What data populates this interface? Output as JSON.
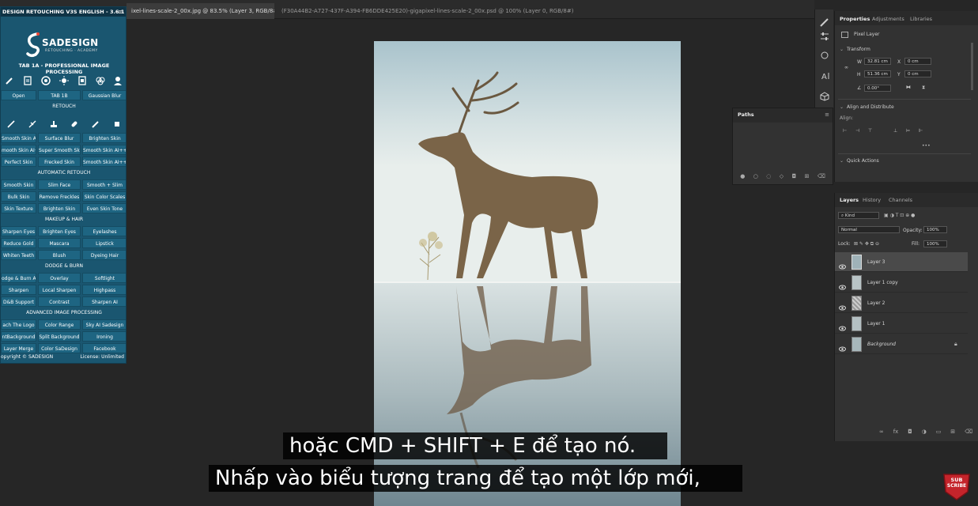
{
  "tabs": {
    "active": "ixel-lines-scale-2_00x.jpg @ 83.5% (Layer 3, RGB/8#) *",
    "second": "(F30A44B2-A727-437F-A394-FB6DDE425E20)-gigapixel-lines-scale-2_00x.psd @ 100% (Layer 0, RGB/8#)",
    "close": "×"
  },
  "plugin": {
    "title": "DESIGN RETOUCHING V3S ENGLISH - 3.6.1",
    "menu": "≡",
    "logo_name": "SADESIGN",
    "logo_sub": "RETOUCHING · ACADEMY",
    "tab_heading": "TAB 1A - PROFESSIONAL IMAGE PROCESSING",
    "top_buttons": [
      "Open",
      "TAB 1B",
      "Gaussian Blur"
    ],
    "sections": [
      {
        "title": "RETOUCH"
      },
      {
        "title": "AUTOMATIC RETOUCH"
      },
      {
        "title": "MAKEUP & HAIR"
      },
      {
        "title": "DODGE & BURN"
      },
      {
        "title": "ADVANCED IMAGE PROCESSING"
      }
    ],
    "retouch_rows": [
      [
        "Smooth Skin AI",
        "Surface Blur",
        "Brighten Skin"
      ],
      [
        "mooth Skin AI+",
        "Super Smooth Skin",
        "Smooth Skin AI++"
      ],
      [
        "Perfect Skin",
        "Frecked Skin",
        "Smooth Skin AI+++"
      ]
    ],
    "auto_rows": [
      [
        "Smooth Skin",
        "Slim Face",
        "Smooth + Slim"
      ],
      [
        "Bulk Skin",
        "Remove Freckles",
        "Skin Color Scales"
      ],
      [
        "Skin Texture",
        "Brighten Skin",
        "Even Skin Tone"
      ]
    ],
    "makeup_rows": [
      [
        "Sharpen Eyes",
        "Brighten Eyes",
        "Eyelashes"
      ],
      [
        "Reduce Gold",
        "Mascara",
        "Lipstick"
      ],
      [
        "Whiten Teeth",
        "Blush",
        "Dyeing Hair"
      ]
    ],
    "dodge_rows": [
      [
        "odge & Burn AI",
        "Overlay",
        "Softlight"
      ],
      [
        "Sharpen",
        "Local Sharpen",
        "Highpass"
      ],
      [
        "D&B Support",
        "Contrast",
        "Sharpen AI"
      ]
    ],
    "advanced_rows": [
      [
        "ach The Logo",
        "Color Range",
        "Sky AI Sadesign"
      ],
      [
        "ntBackground",
        "Split Background",
        "Ironing"
      ],
      [
        "Layer Merge",
        "Color SaDesign",
        "Facebook"
      ]
    ],
    "footer_left": "opyright © SADESIGN",
    "footer_right": "License: Unlimited"
  },
  "properties": {
    "tabs": [
      "Properties",
      "Adjustments",
      "Libraries"
    ],
    "kind": "Pixel Layer",
    "transform_title": "Transform",
    "w_label": "W",
    "w_value": "32.81 cm",
    "h_label": "H",
    "h_value": "51.36 cm",
    "x_label": "X",
    "x_value": "0 cm",
    "y_label": "Y",
    "y_value": "0 cm",
    "angle_value": "0.00°",
    "align_title": "Align and Distribute",
    "align_label": "Align:",
    "more": "•••",
    "quick_actions": "Quick Actions"
  },
  "paths": {
    "title": "Paths"
  },
  "layers": {
    "tabs": [
      "Layers",
      "History",
      "Channels"
    ],
    "filter_kind": "Kind",
    "blend_mode": "Normal",
    "opacity_label": "Opacity:",
    "opacity_value": "100%",
    "lock_label": "Lock:",
    "fill_label": "Fill:",
    "fill_value": "100%",
    "items": [
      {
        "name": "Layer 3"
      },
      {
        "name": "Layer 1 copy"
      },
      {
        "name": "Layer 2"
      },
      {
        "name": "Layer 1"
      },
      {
        "name": "Background"
      }
    ]
  },
  "subtitles": {
    "line1": "hoặc CMD + SHIFT + E để tạo nó.",
    "line2": "Nhấp vào biểu tượng trang để tạo một lớp mới,"
  },
  "subscribe": {
    "line1": "SUB",
    "line2": "SCRIBE"
  },
  "colors": {
    "plugin_bg": "#1a5670",
    "app_bg": "#262626",
    "panel_bg": "#323232",
    "selected_layer": "#4a4a4a"
  }
}
